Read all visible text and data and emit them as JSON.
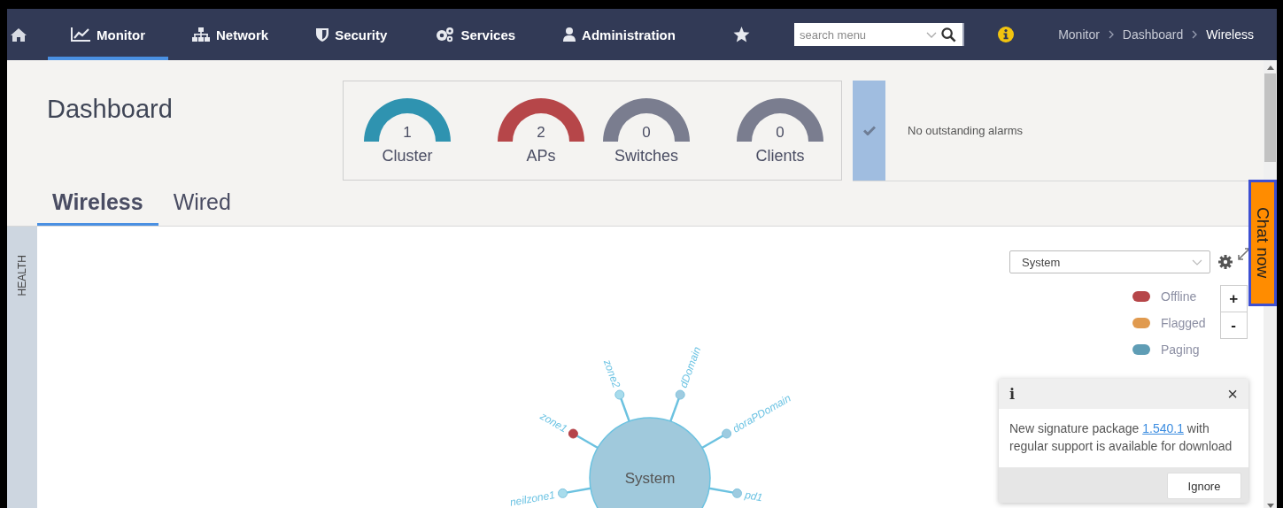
{
  "nav": {
    "items": [
      {
        "label": "Monitor",
        "selected": true
      },
      {
        "label": "Network",
        "selected": false
      },
      {
        "label": "Security",
        "selected": false
      },
      {
        "label": "Services",
        "selected": false
      },
      {
        "label": "Administration",
        "selected": false
      }
    ],
    "search": {
      "placeholder": "search menu"
    },
    "breadcrumb": [
      "Monitor",
      "Dashboard",
      "Wireless"
    ]
  },
  "page_title": "Dashboard",
  "summary": [
    {
      "value": "1",
      "label": "Cluster",
      "color": "#2f93b0"
    },
    {
      "value": "2",
      "label": "APs",
      "color": "#b64649"
    },
    {
      "value": "0",
      "label": "Switches",
      "color": "#7a7d8f"
    },
    {
      "value": "0",
      "label": "Clients",
      "color": "#7a7d8f"
    }
  ],
  "alarms": {
    "message": "No outstanding alarms"
  },
  "tabs": [
    {
      "label": "Wireless",
      "selected": true
    },
    {
      "label": "Wired",
      "selected": false
    }
  ],
  "sidebar": {
    "label": "HEALTH"
  },
  "topology": {
    "root": "System",
    "nodes": [
      {
        "label": "zone1",
        "color": "#b5444a"
      },
      {
        "label": "zone2",
        "color": "#a8dcec"
      },
      {
        "label": "dDomain",
        "color": "#9ecbe0"
      },
      {
        "label": "doraPDomain",
        "color": "#9ecbe0"
      },
      {
        "label": "pd1",
        "color": "#9ecbe0"
      },
      {
        "label": "neilzone1",
        "color": "#a8dcec"
      }
    ]
  },
  "view_select": {
    "value": "System"
  },
  "legend": [
    {
      "label": "Offline",
      "color": "#b64649"
    },
    {
      "label": "Flagged",
      "color": "#e09a4f"
    },
    {
      "label": "Paging",
      "color": "#5f9db5"
    }
  ],
  "zoom": [
    "+",
    "-"
  ],
  "chat": {
    "label": "Chat now"
  },
  "notification": {
    "icon": "i",
    "close": "×",
    "before": "New signature package ",
    "link": "1.540.1",
    "after": " with regular support is available for download",
    "button": "Ignore"
  }
}
